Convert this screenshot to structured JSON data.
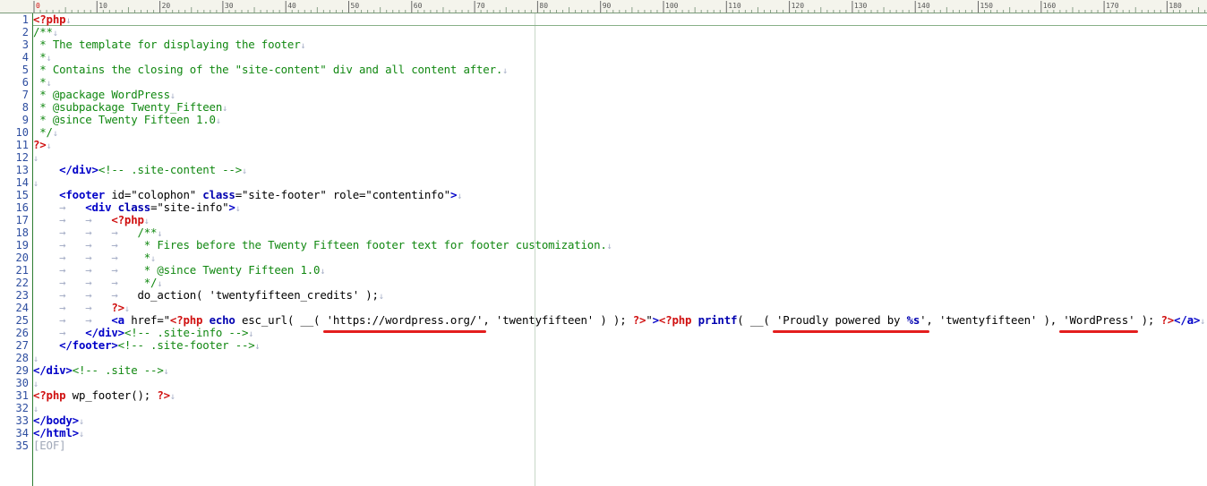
{
  "ruler": {
    "labels": [
      "0",
      "10",
      "20",
      "30",
      "40",
      "50",
      "60",
      "70",
      "80",
      "90",
      "100",
      "110",
      "120",
      "130",
      "140",
      "150",
      "160",
      "170",
      "180"
    ]
  },
  "lines": [
    {
      "n": "1",
      "segs": [
        [
          "tagr",
          "<?php"
        ],
        [
          "nl",
          "↓"
        ]
      ]
    },
    {
      "n": "2",
      "segs": [
        [
          "cmt",
          "/**"
        ],
        [
          "nl",
          "↓"
        ]
      ]
    },
    {
      "n": "3",
      "segs": [
        [
          "cmt",
          " * The template for displaying the footer"
        ],
        [
          "nl",
          "↓"
        ]
      ]
    },
    {
      "n": "4",
      "segs": [
        [
          "cmt",
          " *"
        ],
        [
          "nl",
          "↓"
        ]
      ]
    },
    {
      "n": "5",
      "segs": [
        [
          "cmt",
          " * Contains the closing of the \"site-content\" div and all content after."
        ],
        [
          "nl",
          "↓"
        ]
      ]
    },
    {
      "n": "6",
      "segs": [
        [
          "cmt",
          " *"
        ],
        [
          "nl",
          "↓"
        ]
      ]
    },
    {
      "n": "7",
      "segs": [
        [
          "cmt",
          " * @package WordPress"
        ],
        [
          "nl",
          "↓"
        ]
      ]
    },
    {
      "n": "8",
      "segs": [
        [
          "cmt",
          " * @subpackage Twenty_Fifteen"
        ],
        [
          "nl",
          "↓"
        ]
      ]
    },
    {
      "n": "9",
      "segs": [
        [
          "cmt",
          " * @since Twenty Fifteen 1.0"
        ],
        [
          "nl",
          "↓"
        ]
      ]
    },
    {
      "n": "10",
      "segs": [
        [
          "cmt",
          " */"
        ],
        [
          "nl",
          "↓"
        ]
      ]
    },
    {
      "n": "11",
      "segs": [
        [
          "tagr",
          "?>"
        ],
        [
          "nl",
          "↓"
        ]
      ]
    },
    {
      "n": "12",
      "segs": [
        [
          "nl",
          "↓"
        ]
      ]
    },
    {
      "n": "13",
      "segs": [
        [
          "ws",
          "    "
        ],
        [
          "tag",
          "</div>"
        ],
        [
          "cmt",
          "<!-- .site-content -->"
        ],
        [
          "nl",
          "↓"
        ]
      ]
    },
    {
      "n": "14",
      "segs": [
        [
          "nl",
          "↓"
        ]
      ]
    },
    {
      "n": "15",
      "segs": [
        [
          "ws",
          "    "
        ],
        [
          "tag",
          "<footer"
        ],
        [
          "attr",
          " id=\"colophon\" "
        ],
        [
          "kw",
          "class"
        ],
        [
          "attr",
          "=\"site-footer\" role=\"contentinfo\""
        ],
        [
          "tag",
          ">"
        ],
        [
          "nl",
          "↓"
        ]
      ]
    },
    {
      "n": "16",
      "segs": [
        [
          "ws",
          "    →   "
        ],
        [
          "tag",
          "<div"
        ],
        [
          "kw",
          " class"
        ],
        [
          "attr",
          "=\"site-info\""
        ],
        [
          "tag",
          ">"
        ],
        [
          "nl",
          "↓"
        ]
      ]
    },
    {
      "n": "17",
      "segs": [
        [
          "ws",
          "    →   →   "
        ],
        [
          "tagr",
          "<?php"
        ],
        [
          "nl",
          "↓"
        ]
      ]
    },
    {
      "n": "18",
      "segs": [
        [
          "ws",
          "    →   →   →   "
        ],
        [
          "cmt",
          "/**"
        ],
        [
          "nl",
          "↓"
        ]
      ]
    },
    {
      "n": "19",
      "segs": [
        [
          "ws",
          "    →   →   →   "
        ],
        [
          "cmt",
          " * Fires before the Twenty Fifteen footer text for footer customization."
        ],
        [
          "nl",
          "↓"
        ]
      ]
    },
    {
      "n": "20",
      "segs": [
        [
          "ws",
          "    →   →   →   "
        ],
        [
          "cmt",
          " *"
        ],
        [
          "nl",
          "↓"
        ]
      ]
    },
    {
      "n": "21",
      "segs": [
        [
          "ws",
          "    →   →   →   "
        ],
        [
          "cmt",
          " * @since Twenty Fifteen 1.0"
        ],
        [
          "nl",
          "↓"
        ]
      ]
    },
    {
      "n": "22",
      "segs": [
        [
          "ws",
          "    →   →   →   "
        ],
        [
          "cmt",
          " */"
        ],
        [
          "nl",
          "↓"
        ]
      ]
    },
    {
      "n": "23",
      "segs": [
        [
          "ws",
          "    →   →   →   "
        ],
        [
          "str",
          "do_action( 'twentyfifteen_credits' );"
        ],
        [
          "nl",
          "↓"
        ]
      ]
    },
    {
      "n": "24",
      "segs": [
        [
          "ws",
          "    →   →   "
        ],
        [
          "tagr",
          "?>"
        ],
        [
          "nl",
          "↓"
        ]
      ]
    },
    {
      "n": "25",
      "segs": [
        [
          "ws",
          "    →   →   "
        ],
        [
          "tag",
          "<a"
        ],
        [
          "attr",
          " href=\""
        ],
        [
          "tagr",
          "<?php"
        ],
        [
          "kw",
          " echo"
        ],
        [
          "str",
          " esc_url( __( 'https://wordpress.org/', 'twentyfifteen' ) ); "
        ],
        [
          "tagr",
          "?>"
        ],
        [
          "attr",
          "\""
        ],
        [
          "tag",
          ">"
        ],
        [
          "tagr",
          "<?php"
        ],
        [
          "kw",
          " printf"
        ],
        [
          "str",
          "( __( 'Proudly powered by "
        ],
        [
          "kw",
          "%s"
        ],
        [
          "str",
          "', 'twentyfifteen' ), 'WordPress' ); "
        ],
        [
          "tagr",
          "?>"
        ],
        [
          "tag",
          "</a>"
        ],
        [
          "nl",
          "↓"
        ]
      ]
    },
    {
      "n": "26",
      "segs": [
        [
          "ws",
          "    →   "
        ],
        [
          "tag",
          "</div>"
        ],
        [
          "cmt",
          "<!-- .site-info -->"
        ],
        [
          "nl",
          "↓"
        ]
      ]
    },
    {
      "n": "27",
      "segs": [
        [
          "ws",
          "    "
        ],
        [
          "tag",
          "</footer>"
        ],
        [
          "cmt",
          "<!-- .site-footer -->"
        ],
        [
          "nl",
          "↓"
        ]
      ]
    },
    {
      "n": "28",
      "segs": [
        [
          "nl",
          "↓"
        ]
      ]
    },
    {
      "n": "29",
      "segs": [
        [
          "tag",
          "</div>"
        ],
        [
          "cmt",
          "<!-- .site -->"
        ],
        [
          "nl",
          "↓"
        ]
      ]
    },
    {
      "n": "30",
      "segs": [
        [
          "nl",
          "↓"
        ]
      ]
    },
    {
      "n": "31",
      "segs": [
        [
          "tagr",
          "<?php"
        ],
        [
          "str",
          " wp_footer(); "
        ],
        [
          "tagr",
          "?>"
        ],
        [
          "nl",
          "↓"
        ]
      ]
    },
    {
      "n": "32",
      "segs": [
        [
          "nl",
          "↓"
        ]
      ]
    },
    {
      "n": "33",
      "segs": [
        [
          "tag",
          "</body>"
        ],
        [
          "nl",
          "↓"
        ]
      ]
    },
    {
      "n": "34",
      "segs": [
        [
          "tag",
          "</html>"
        ],
        [
          "nl",
          "↓"
        ]
      ]
    },
    {
      "n": "35",
      "segs": [
        [
          "eof",
          "[EOF]"
        ]
      ]
    }
  ],
  "colors": {
    "annotation_underline": "#e41e1e",
    "php_tag": "#d01010",
    "html_tag": "#0000c8",
    "comment": "#118811"
  },
  "annotations": [
    "underline-url",
    "underline-proudly-powered-by",
    "underline-wordpress"
  ]
}
